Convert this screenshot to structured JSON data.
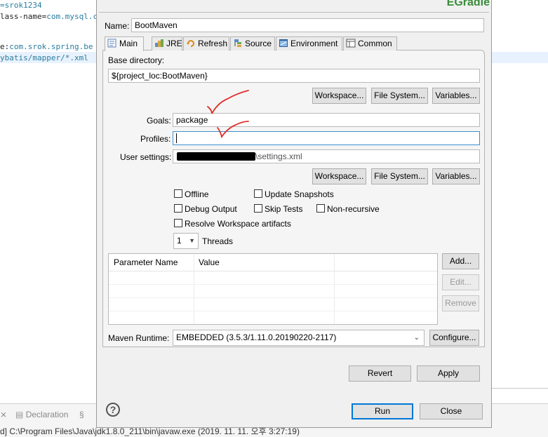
{
  "editor": {
    "lines": [
      {
        "parts": [
          {
            "t": "=srok1234",
            "c": "c-blue"
          }
        ]
      },
      {
        "parts": [
          {
            "t": "lass-name=",
            "c": "c-dark"
          },
          {
            "t": "com.mysql.c",
            "c": "c-blue"
          }
        ]
      },
      {
        "parts": [
          {
            "t": "e:",
            "c": "c-dark"
          },
          {
            "t": "com.srok.spring.be",
            "c": "c-blue"
          }
        ]
      },
      {
        "parts": [
          {
            "t": "ybatis/mapper/*.xml",
            "c": "c-blue"
          }
        ]
      }
    ]
  },
  "bottom_panel": {
    "tab_declaration": "Declaration",
    "console_text": "d] C:\\Program Files\\Java\\jdk1.8.0_211\\bin\\javaw.exe (2019. 11. 11. 오후 3:27:19)"
  },
  "dialog": {
    "plugin_title": "EGradle",
    "name_label": "Name:",
    "name_value": "BootMaven",
    "tabs": [
      {
        "label": "Main",
        "icon": "main-tab-icon"
      },
      {
        "label": "JRE",
        "icon": "jre-icon"
      },
      {
        "label": "Refresh",
        "icon": "refresh-icon"
      },
      {
        "label": "Source",
        "icon": "source-icon"
      },
      {
        "label": "Environment",
        "icon": "environment-icon"
      },
      {
        "label": "Common",
        "icon": "common-icon"
      }
    ],
    "base_dir_label": "Base directory:",
    "base_dir_value": "${project_loc:BootMaven}",
    "workspace_btn": "Workspace...",
    "filesystem_btn": "File System...",
    "variables_btn": "Variables...",
    "goals_label": "Goals:",
    "goals_value": "package",
    "profiles_label": "Profiles:",
    "profiles_value": "",
    "user_settings_label": "User settings:",
    "user_settings_value": "\\settings.xml",
    "checkboxes": {
      "offline": "Offline",
      "update_snapshots": "Update Snapshots",
      "debug_output": "Debug Output",
      "skip_tests": "Skip Tests",
      "non_recursive": "Non-recursive",
      "resolve_workspace": "Resolve Workspace artifacts"
    },
    "threads_value": "1",
    "threads_label": "Threads",
    "param_table": {
      "col_name": "Parameter Name",
      "col_value": "Value"
    },
    "add_btn": "Add...",
    "edit_btn": "Edit...",
    "remove_btn": "Remove",
    "maven_runtime_label": "Maven Runtime:",
    "maven_runtime_value": "EMBEDDED (3.5.3/1.11.0.20190220-2117)",
    "configure_btn": "Configure...",
    "revert_btn": "Revert",
    "apply_btn": "Apply",
    "run_btn": "Run",
    "close_btn": "Close"
  }
}
